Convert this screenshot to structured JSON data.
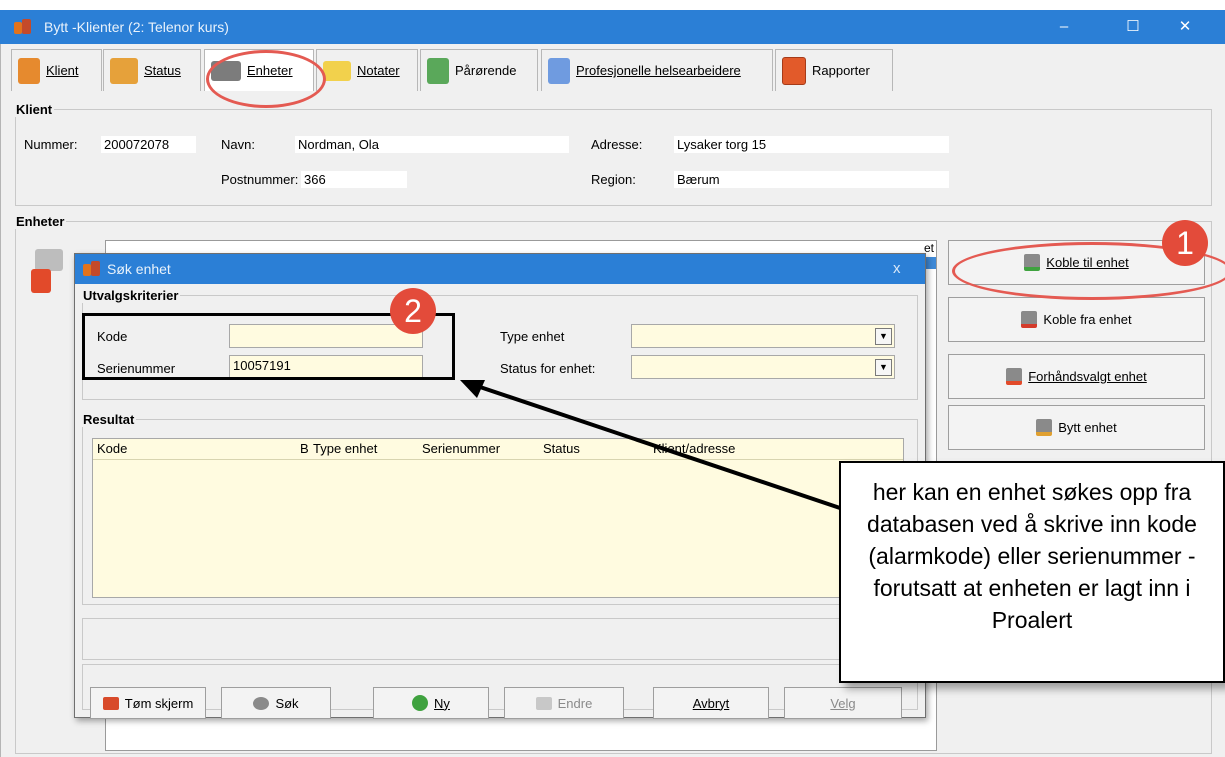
{
  "window": {
    "title": "Bytt -Klienter (2: Telenor kurs)",
    "minimize": "‒",
    "maximize": "☐",
    "close": "✕"
  },
  "tabs": [
    {
      "label": "Klient"
    },
    {
      "label": "Status"
    },
    {
      "label": "Enheter"
    },
    {
      "label": "Notater"
    },
    {
      "label": "Pårørende"
    },
    {
      "label": "Profesjonelle helsearbeidere"
    },
    {
      "label": "Rapporter"
    }
  ],
  "klient": {
    "legend": "Klient",
    "nummer_label": "Nummer:",
    "nummer": "200072078",
    "navn_label": "Navn:",
    "navn": "Nordman, Ola",
    "adresse_label": "Adresse:",
    "adresse": "Lysaker torg 15",
    "postnummer_label": "Postnummer:",
    "postnummer": "366",
    "region_label": "Region:",
    "region": "Bærum"
  },
  "enheter": {
    "legend": "Enheter",
    "col_hint": "et"
  },
  "side_buttons": {
    "koble_til": "Koble til enhet",
    "koble_fra": "Koble fra enhet",
    "forhandsvalgt": "Forhåndsvalgt enhet",
    "bytt": "Bytt enhet"
  },
  "dialog": {
    "title": "Søk enhet",
    "close": "x",
    "utvalg_legend": "Utvalgskriterier",
    "kode_label": "Kode",
    "kode_value": "",
    "serienummer_label": "Serienummer",
    "serienummer_value": "10057191",
    "type_enhet_label": "Type enhet",
    "type_enhet_value": "",
    "status_label": "Status for enhet:",
    "status_value": "",
    "resultat_legend": "Resultat",
    "columns": [
      "Kode",
      "B",
      "Type enhet",
      "Serienummer",
      "Status",
      "Klient/adresse"
    ],
    "buttons": {
      "tom": "Tøm skjerm",
      "sok": "Søk",
      "ny": "Ny",
      "endre": "Endre",
      "avbryt": "Avbryt",
      "velg": "Velg"
    }
  },
  "annotations": {
    "badge1": "1",
    "badge2": "2",
    "callout": "her kan en enhet søkes opp fra databasen ved å skrive inn kode (alarmkode) eller serienummer - forutsatt at enheten er lagt inn i Proalert"
  },
  "colors": {
    "titlebar": "#2b7fd6",
    "field_bg": "#fffbe0",
    "annotation_red": "#e34b3a"
  }
}
